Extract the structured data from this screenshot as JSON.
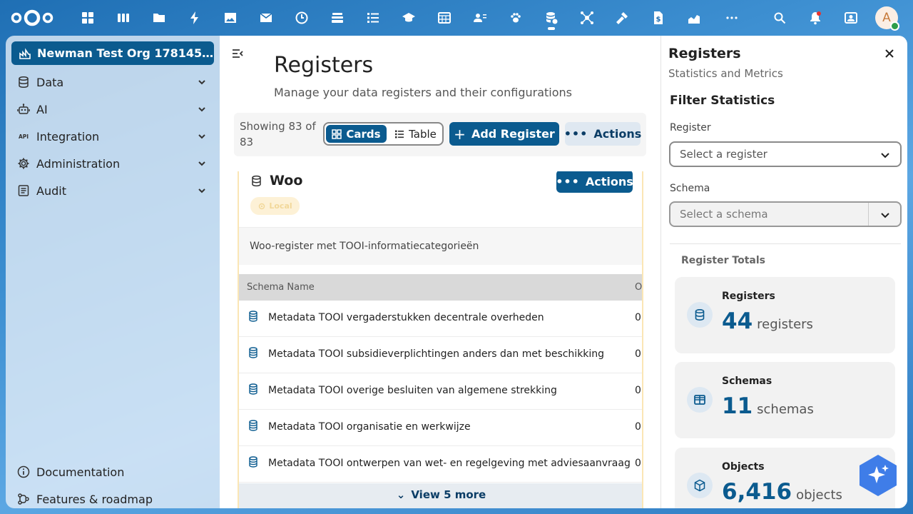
{
  "topbar": {
    "apps": [
      "dashboard-icon",
      "deck-icon",
      "files-icon",
      "activity-icon",
      "photos-icon",
      "mail-icon",
      "clock-icon",
      "stack-icon",
      "tasks-icon",
      "learn-icon",
      "calendar-icon",
      "contacts-icon",
      "paw-icon",
      "openregister-icon",
      "network-icon",
      "hammer-icon",
      "document-money-icon",
      "chart-icon",
      "more-icon"
    ],
    "avatar_initial": "A",
    "colors": {
      "accent": "#0b5b8f",
      "topbar_bg": "#1f6fb4"
    }
  },
  "sidebar": {
    "org_name": "Newman Test Org 178145…",
    "items": [
      {
        "label": "Data",
        "icon": "database-icon"
      },
      {
        "label": "AI",
        "icon": "robot-icon"
      },
      {
        "label": "Integration",
        "icon": "api-icon"
      },
      {
        "label": "Administration",
        "icon": "gear-icon"
      },
      {
        "label": "Audit",
        "icon": "audit-icon"
      }
    ],
    "footer": [
      {
        "label": "Documentation",
        "icon": "info-icon"
      },
      {
        "label": "Features & roadmap",
        "icon": "roadmap-icon"
      }
    ]
  },
  "main": {
    "title": "Registers",
    "subtitle": "Manage your data registers and their configurations",
    "showing": "Showing 83 of 83",
    "view_toggle": {
      "cards": "Cards",
      "table": "Table",
      "selected": "Cards"
    },
    "add_label": "Add Register",
    "actions_label": "Actions",
    "card": {
      "name": "Woo",
      "badge": "Local",
      "actions_label": "Actions",
      "description": "Woo-register met TOOI-informatiecategorieën",
      "columns": [
        "Schema Name",
        "O"
      ],
      "rows": [
        {
          "name": "Metadata TOOI vergaderstukken decentrale overheden",
          "count": "0"
        },
        {
          "name": "Metadata TOOI subsidieverplichtingen anders dan met beschikking",
          "count": "0"
        },
        {
          "name": "Metadata TOOI overige besluiten van algemene strekking",
          "count": "0"
        },
        {
          "name": "Metadata TOOI organisatie en werkwijze",
          "count": "0"
        },
        {
          "name": "Metadata TOOI ontwerpen van wet- en regelgeving met adviesaanvraag",
          "count": "0"
        }
      ],
      "view_more": "View 5 more"
    }
  },
  "panel": {
    "title": "Registers",
    "subtitle": "Statistics and Metrics",
    "filter_title": "Filter Statistics",
    "register_label": "Register",
    "register_placeholder": "Select a register",
    "schema_label": "Schema",
    "schema_placeholder": "Select a schema",
    "totals_title": "Register Totals",
    "stats": [
      {
        "label": "Registers",
        "value": "44",
        "unit": "registers",
        "icon": "database-icon"
      },
      {
        "label": "Schemas",
        "value": "11",
        "unit": "schemas",
        "icon": "table-icon"
      },
      {
        "label": "Objects",
        "value": "6,416",
        "unit": "objects",
        "icon": "cube-icon"
      }
    ]
  }
}
